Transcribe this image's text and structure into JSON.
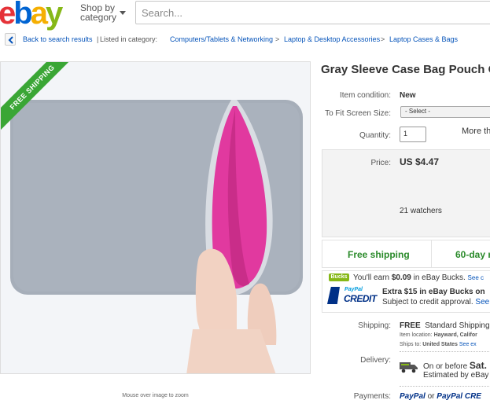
{
  "header": {
    "logo_letters": [
      "e",
      "b",
      "a",
      "y"
    ],
    "shop_by_category": [
      "Shop by",
      "category"
    ],
    "search_placeholder": "Search..."
  },
  "breadcrumb": {
    "back_label": "Back to search results",
    "separator": "|",
    "listed_in": "Listed in category:",
    "categories": [
      "Computers/Tablets & Networking",
      "Laptop & Desktop Accessories",
      "Laptop Cases & Bags"
    ],
    "arrow": ">"
  },
  "image": {
    "ribbon": "FREE SHIPPING",
    "caption": "Mouse over image to zoom"
  },
  "item": {
    "title": "Gray Sleeve Case Bag Pouch Co",
    "condition_label": "Item condition:",
    "condition_value": "New",
    "screen_size_label": "To Fit Screen Size:",
    "screen_size_value": "- Select -",
    "quantity_label": "Quantity:",
    "quantity_value": "1",
    "more_text": "More th",
    "price_label": "Price:",
    "price_value": "US $4.47",
    "watchers": "21 watchers"
  },
  "shipping_banner": {
    "free_shipping": "Free shipping",
    "returns": "60-day r"
  },
  "bucks": {
    "badge": "Bucks",
    "text_pre": "You'll earn ",
    "amount": "$0.09",
    "text_post": " in eBay Bucks.",
    "see": "See c"
  },
  "credit": {
    "paypal": "PayPal",
    "credit": "CREDIT",
    "line1": "Extra $15 in eBay Bucks on",
    "line2": "Subject to credit approval.",
    "see": "See"
  },
  "shipping": {
    "label": "Shipping:",
    "free": "FREE",
    "method": "Standard Shipping",
    "location_label": "Item location:",
    "location": "Hayward, Califor",
    "ships_to_label": "Ships to:",
    "ships_to": "United States",
    "see_exclusions": "See ex"
  },
  "delivery": {
    "label": "Delivery:",
    "line1_pre": "On or before ",
    "line1_day": "Sat.",
    "line2": "Estimated by eBay"
  },
  "payments": {
    "label": "Payments:",
    "pp1": "PayPal",
    "or": "or",
    "pp2": "PayPal CRE"
  },
  "colors": {
    "ebay_red": "#e53238",
    "ebay_blue": "#0064d2",
    "ebay_yellow": "#f5af02",
    "ebay_green": "#86b817",
    "link_blue": "#0654ba",
    "free_green": "#2a8a2a",
    "sleeve_gray": "#a9b1bb",
    "lining_pink": "#e33fa3"
  }
}
